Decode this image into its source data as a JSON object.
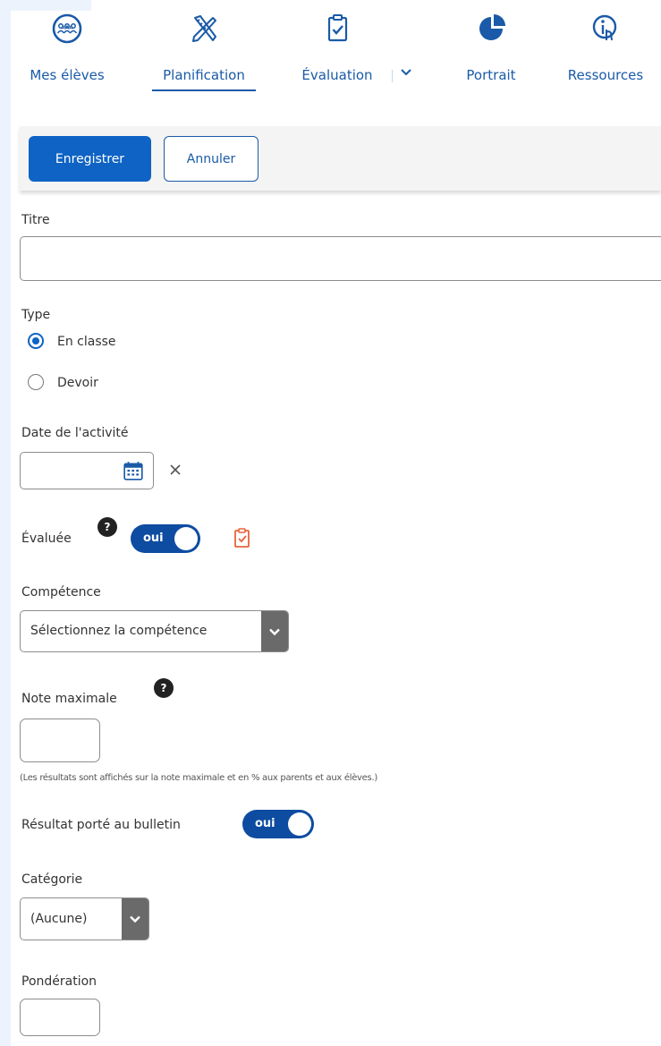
{
  "nav": {
    "items": [
      {
        "label": "Mes élèves",
        "icon": "students-icon"
      },
      {
        "label": "Planification",
        "icon": "pencil-ruler-icon",
        "active": true
      },
      {
        "label": "Évaluation",
        "icon": "clipboard-check-icon"
      },
      {
        "label": "Portrait",
        "icon": "pie-chart-icon"
      },
      {
        "label": "Ressources",
        "icon": "info-hand-icon"
      }
    ],
    "dropdown_icon": "chevron-down-icon"
  },
  "toolbar": {
    "save_label": "Enregistrer",
    "cancel_label": "Annuler"
  },
  "form": {
    "title_label": "Titre",
    "title_value": "",
    "type_label": "Type",
    "type_options": [
      {
        "label": "En classe",
        "selected": true
      },
      {
        "label": "Devoir",
        "selected": false
      }
    ],
    "date_label": "Date de l'activité",
    "date_value": "",
    "date_calendar_icon": "calendar-icon",
    "date_clear_icon": "close-icon",
    "evaluated_label": "Évaluée",
    "evaluated_help": "?",
    "evaluated_toggle": "oui",
    "evaluated_icon": "clipboard-check-icon",
    "competence_label": "Compétence",
    "competence_value": "Sélectionnez la compétence",
    "max_grade_label": "Note maximale",
    "max_grade_help": "?",
    "max_grade_value": "",
    "max_grade_hint": "(Les résultats sont affichés sur la note maximale et en % aux parents et aux élèves.)",
    "report_label": "Résultat porté au bulletin",
    "report_toggle": "oui",
    "category_label": "Catégorie",
    "category_value": "(Aucune)",
    "weight_label": "Pondération",
    "weight_value": ""
  },
  "colors": {
    "primary": "#0e63c4",
    "nav_text": "#1a5aa8",
    "toggle_bg": "#0e4ca1",
    "accent_orange": "#e8643a",
    "select_button": "#6a6a6a"
  }
}
